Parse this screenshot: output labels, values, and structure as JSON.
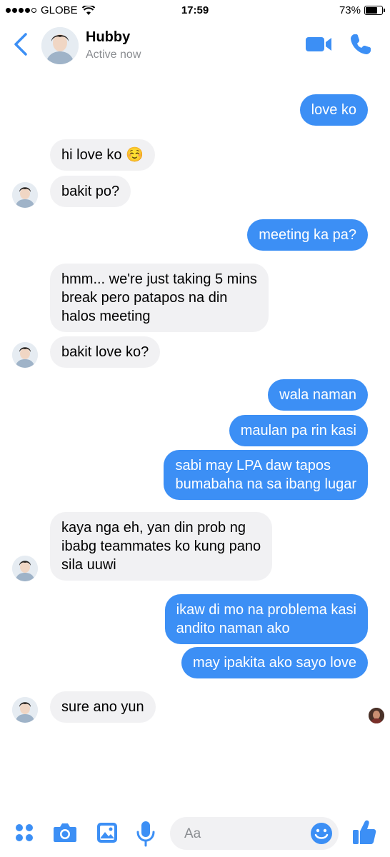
{
  "status_bar": {
    "carrier": "GLOBE",
    "time": "17:59",
    "battery_percent": "73%",
    "battery_level": 0.73
  },
  "header": {
    "name": "Hubby",
    "status": "Active now",
    "icons": [
      "back-chevron-icon",
      "video-call-icon",
      "phone-call-icon"
    ]
  },
  "conversation": {
    "messages": [
      {
        "from": "me",
        "text": "love ko"
      },
      {
        "from": "them",
        "text": "hi love ko ☺️"
      },
      {
        "from": "them",
        "text": "bakit po?"
      },
      {
        "from": "me",
        "text": "meeting ka pa?"
      },
      {
        "from": "them",
        "lines": [
          "hmm... we're just taking 5 mins",
          "break pero patapos na din",
          "halos meeting"
        ]
      },
      {
        "from": "them",
        "text": "bakit love ko?"
      },
      {
        "from": "me",
        "text": "wala naman"
      },
      {
        "from": "me",
        "text": "maulan pa rin kasi"
      },
      {
        "from": "me",
        "lines": [
          "sabi may LPA daw tapos",
          "bumabaha na sa ibang lugar"
        ]
      },
      {
        "from": "them",
        "lines": [
          "kaya nga eh, yan din prob ng",
          "ibabg teammates ko kung pano",
          "sila uuwi"
        ]
      },
      {
        "from": "me",
        "lines": [
          "ikaw di mo na problema kasi",
          "andito naman ako"
        ]
      },
      {
        "from": "me",
        "text": "may ipakita ako sayo love"
      },
      {
        "from": "them",
        "text": "sure ano yun"
      }
    ]
  },
  "composer": {
    "placeholder": "Aa",
    "icons": [
      "apps-icon",
      "camera-icon",
      "image-icon",
      "microphone-icon",
      "emoji-icon",
      "thumbs-up-icon"
    ]
  },
  "colors": {
    "accent": "#3c8ff5",
    "received_bubble": "#f1f1f3",
    "muted_text": "#8a8d91"
  }
}
